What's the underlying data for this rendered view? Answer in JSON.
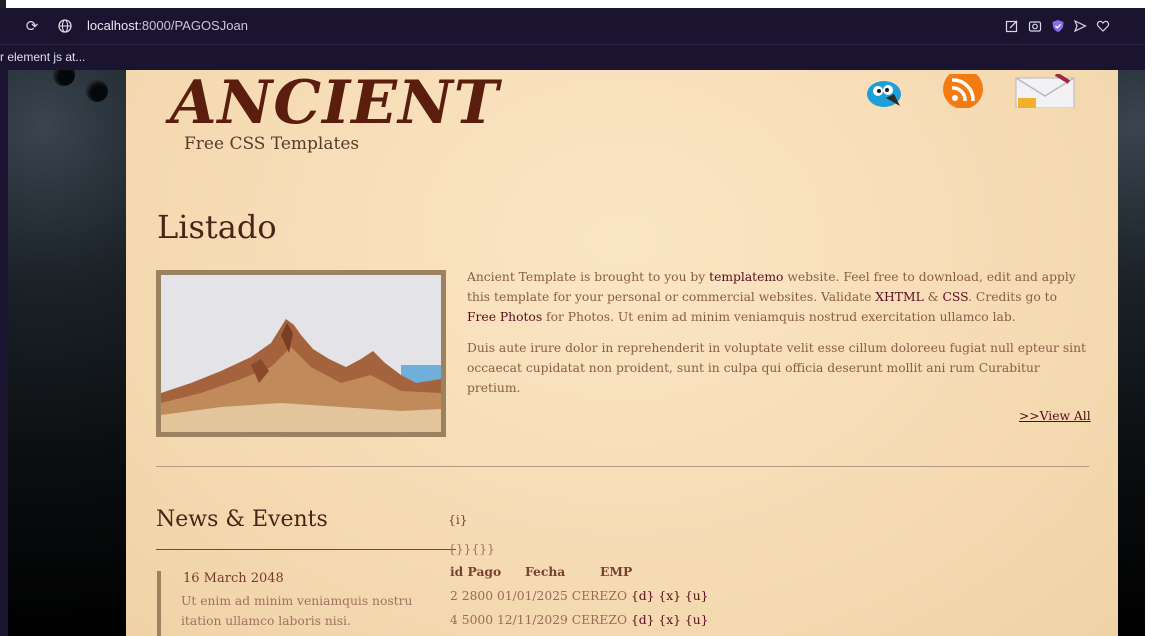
{
  "browser": {
    "url_host": "localhost",
    "url_path": ":8000/PAGOSJoan",
    "bookmark": "r element js at..."
  },
  "header": {
    "logo": "ANCIENT",
    "subtitle": "Free CSS Templates"
  },
  "main": {
    "title": "Listado",
    "para1": {
      "t1": "Ancient Template is brought to you by ",
      "link1": "templatemo",
      "t2": " website. Feel free to download, edit and apply this template for your personal or commercial websites. Validate ",
      "link2": "XHTML",
      "t3": " & ",
      "link3": "CSS",
      "t4": ". Credits go to ",
      "link4": "Free Photos",
      "t5": " for Photos. Ut enim ad minim veniamquis nostrud exercitation ullamco lab."
    },
    "para2": "Duis aute irure dolor in reprehenderit in voluptate velit esse cillum doloreeu fugiat null epteur sint occaecat cupidatat non proident, sunt in culpa qui officia deserunt mollit ani rum Curabitur pretium.",
    "view_all": ">>View All"
  },
  "news": {
    "title": "News & Events",
    "date": "16 March 2048",
    "text": "Ut enim ad minim veniamquis nostru itation ullamco laboris nisi."
  },
  "listing": {
    "placeholder_i": "{i}",
    "placeholder_braces": "{}}{}}",
    "headers": [
      "id Pago",
      "Fecha",
      "EMP"
    ],
    "rows": [
      {
        "id": "2",
        "pago": "2800",
        "fecha": "01/01/2025",
        "emp": "CEREZO",
        "d": "{d}",
        "x": "{x}",
        "u": "{u}"
      },
      {
        "id": "4",
        "pago": "5000",
        "fecha": "12/11/2029",
        "emp": "CEREZO",
        "d": "{d}",
        "x": "{x}",
        "u": "{u}"
      }
    ]
  },
  "colors": {
    "chrome": "#1b1430",
    "parchment": "#f6dcb5",
    "logo": "#5a1d0e",
    "link": "#5a0a1e"
  }
}
